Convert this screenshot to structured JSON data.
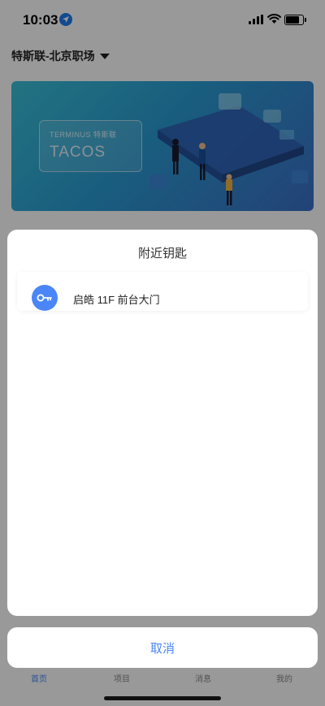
{
  "status_bar": {
    "time": "10:03"
  },
  "header": {
    "location": "特斯联-北京职场"
  },
  "banner": {
    "brand": "TERMINUS 特斯联",
    "product": "TACOS"
  },
  "tab_bar": {
    "tabs": [
      {
        "label": "首页"
      },
      {
        "label": "项目"
      },
      {
        "label": "消息"
      },
      {
        "label": "我的"
      }
    ]
  },
  "sheet": {
    "title": "附近钥匙",
    "keys": [
      {
        "label": "启皓 11F 前台大门",
        "icon": "key-icon"
      }
    ],
    "cancel_label": "取消"
  },
  "colors": {
    "accent": "#4a86f7",
    "location_icon": "#1e7cf2",
    "overlay": "rgba(0,0,0,0.40)",
    "banner_gradient": [
      "#3ac0d8",
      "#2a9cd3",
      "#3b6fc8"
    ]
  }
}
